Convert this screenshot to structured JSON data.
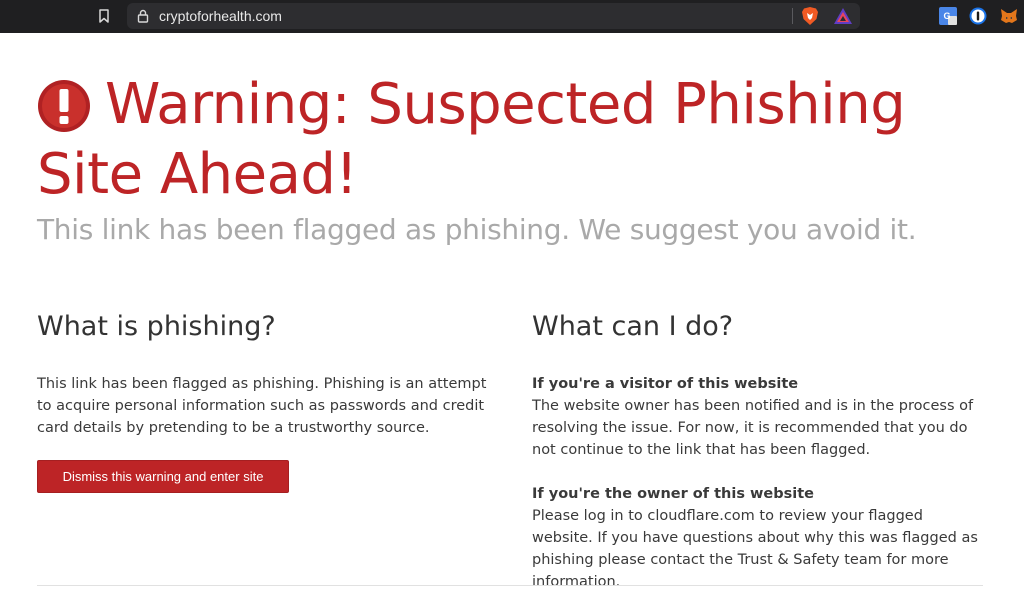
{
  "browser": {
    "url": "cryptoforhealth.com",
    "icons": {
      "bookmark": "bookmark-icon",
      "lock": "lock-icon",
      "brave_shield": "brave-shield-icon",
      "brave_rewards": "brave-rewards-icon",
      "extensions": [
        "google-translate-icon",
        "1password-icon",
        "metamask-fox-icon"
      ]
    }
  },
  "warning": {
    "icon": "exclamation-circle-icon",
    "title": "Warning: Suspected Phishing Site Ahead!",
    "subtitle": "This link has been flagged as phishing. We suggest you avoid it."
  },
  "left": {
    "heading": "What is phishing?",
    "body": "This link has been flagged as phishing. Phishing is an attempt to acquire personal information such as passwords and credit card details by pretending to be a trustworthy source.",
    "button_label": "Dismiss this warning and enter site"
  },
  "right": {
    "heading": "What can I do?",
    "visitor_title": "If you're a visitor of this website",
    "visitor_body": "The website owner has been notified and is in the process of resolving the issue. For now, it is recommended that you do not continue to the link that has been flagged.",
    "owner_title": "If you're the owner of this website",
    "owner_body": "Please log in to cloudflare.com to review your flagged website. If you have questions about why this was flagged as phishing please contact the Trust & Safety team for more information."
  },
  "colors": {
    "accent": "#bd2426",
    "subtitle": "#a9a9a9",
    "chrome": "#1f1f21"
  }
}
